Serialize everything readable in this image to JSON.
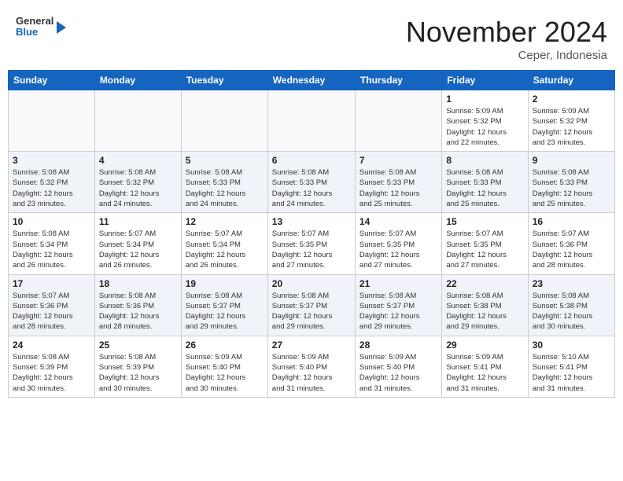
{
  "header": {
    "logo_general": "General",
    "logo_blue": "Blue",
    "month_year": "November 2024",
    "location": "Ceper, Indonesia"
  },
  "days_of_week": [
    "Sunday",
    "Monday",
    "Tuesday",
    "Wednesday",
    "Thursday",
    "Friday",
    "Saturday"
  ],
  "weeks": [
    [
      {
        "day": "",
        "info": ""
      },
      {
        "day": "",
        "info": ""
      },
      {
        "day": "",
        "info": ""
      },
      {
        "day": "",
        "info": ""
      },
      {
        "day": "",
        "info": ""
      },
      {
        "day": "1",
        "info": "Sunrise: 5:09 AM\nSunset: 5:32 PM\nDaylight: 12 hours\nand 22 minutes."
      },
      {
        "day": "2",
        "info": "Sunrise: 5:09 AM\nSunset: 5:32 PM\nDaylight: 12 hours\nand 23 minutes."
      }
    ],
    [
      {
        "day": "3",
        "info": "Sunrise: 5:08 AM\nSunset: 5:32 PM\nDaylight: 12 hours\nand 23 minutes."
      },
      {
        "day": "4",
        "info": "Sunrise: 5:08 AM\nSunset: 5:32 PM\nDaylight: 12 hours\nand 24 minutes."
      },
      {
        "day": "5",
        "info": "Sunrise: 5:08 AM\nSunset: 5:33 PM\nDaylight: 12 hours\nand 24 minutes."
      },
      {
        "day": "6",
        "info": "Sunrise: 5:08 AM\nSunset: 5:33 PM\nDaylight: 12 hours\nand 24 minutes."
      },
      {
        "day": "7",
        "info": "Sunrise: 5:08 AM\nSunset: 5:33 PM\nDaylight: 12 hours\nand 25 minutes."
      },
      {
        "day": "8",
        "info": "Sunrise: 5:08 AM\nSunset: 5:33 PM\nDaylight: 12 hours\nand 25 minutes."
      },
      {
        "day": "9",
        "info": "Sunrise: 5:08 AM\nSunset: 5:33 PM\nDaylight: 12 hours\nand 25 minutes."
      }
    ],
    [
      {
        "day": "10",
        "info": "Sunrise: 5:08 AM\nSunset: 5:34 PM\nDaylight: 12 hours\nand 26 minutes."
      },
      {
        "day": "11",
        "info": "Sunrise: 5:07 AM\nSunset: 5:34 PM\nDaylight: 12 hours\nand 26 minutes."
      },
      {
        "day": "12",
        "info": "Sunrise: 5:07 AM\nSunset: 5:34 PM\nDaylight: 12 hours\nand 26 minutes."
      },
      {
        "day": "13",
        "info": "Sunrise: 5:07 AM\nSunset: 5:35 PM\nDaylight: 12 hours\nand 27 minutes."
      },
      {
        "day": "14",
        "info": "Sunrise: 5:07 AM\nSunset: 5:35 PM\nDaylight: 12 hours\nand 27 minutes."
      },
      {
        "day": "15",
        "info": "Sunrise: 5:07 AM\nSunset: 5:35 PM\nDaylight: 12 hours\nand 27 minutes."
      },
      {
        "day": "16",
        "info": "Sunrise: 5:07 AM\nSunset: 5:36 PM\nDaylight: 12 hours\nand 28 minutes."
      }
    ],
    [
      {
        "day": "17",
        "info": "Sunrise: 5:07 AM\nSunset: 5:36 PM\nDaylight: 12 hours\nand 28 minutes."
      },
      {
        "day": "18",
        "info": "Sunrise: 5:08 AM\nSunset: 5:36 PM\nDaylight: 12 hours\nand 28 minutes."
      },
      {
        "day": "19",
        "info": "Sunrise: 5:08 AM\nSunset: 5:37 PM\nDaylight: 12 hours\nand 29 minutes."
      },
      {
        "day": "20",
        "info": "Sunrise: 5:08 AM\nSunset: 5:37 PM\nDaylight: 12 hours\nand 29 minutes."
      },
      {
        "day": "21",
        "info": "Sunrise: 5:08 AM\nSunset: 5:37 PM\nDaylight: 12 hours\nand 29 minutes."
      },
      {
        "day": "22",
        "info": "Sunrise: 5:08 AM\nSunset: 5:38 PM\nDaylight: 12 hours\nand 29 minutes."
      },
      {
        "day": "23",
        "info": "Sunrise: 5:08 AM\nSunset: 5:38 PM\nDaylight: 12 hours\nand 30 minutes."
      }
    ],
    [
      {
        "day": "24",
        "info": "Sunrise: 5:08 AM\nSunset: 5:39 PM\nDaylight: 12 hours\nand 30 minutes."
      },
      {
        "day": "25",
        "info": "Sunrise: 5:08 AM\nSunset: 5:39 PM\nDaylight: 12 hours\nand 30 minutes."
      },
      {
        "day": "26",
        "info": "Sunrise: 5:09 AM\nSunset: 5:40 PM\nDaylight: 12 hours\nand 30 minutes."
      },
      {
        "day": "27",
        "info": "Sunrise: 5:09 AM\nSunset: 5:40 PM\nDaylight: 12 hours\nand 31 minutes."
      },
      {
        "day": "28",
        "info": "Sunrise: 5:09 AM\nSunset: 5:40 PM\nDaylight: 12 hours\nand 31 minutes."
      },
      {
        "day": "29",
        "info": "Sunrise: 5:09 AM\nSunset: 5:41 PM\nDaylight: 12 hours\nand 31 minutes."
      },
      {
        "day": "30",
        "info": "Sunrise: 5:10 AM\nSunset: 5:41 PM\nDaylight: 12 hours\nand 31 minutes."
      }
    ]
  ]
}
